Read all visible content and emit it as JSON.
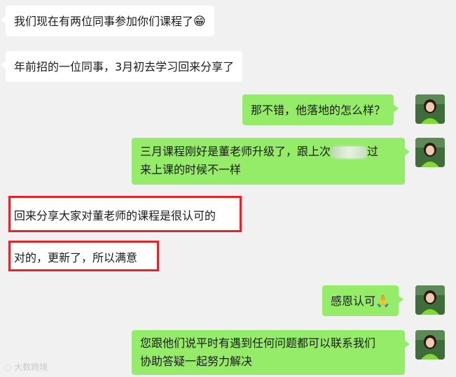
{
  "messages": [
    {
      "side": "left",
      "text": "我们现在有两位同事参加你们课程了",
      "emoji": "😁"
    },
    {
      "side": "left",
      "text": "年前招的一位同事，3月初去学习回来分享了"
    },
    {
      "side": "right",
      "text": "那不错，他落地的怎么样？"
    },
    {
      "side": "right",
      "line1_pre": "三月课程刚好是董老师升级了，跟上次",
      "line1_post": "过",
      "line2": "来上课的时候不一样"
    },
    {
      "side": "left",
      "text": "回来分享大家对董老师的课程是很认可的"
    },
    {
      "side": "left",
      "text": "对的，更新了，所以满意"
    },
    {
      "side": "right",
      "text": "感恩认可",
      "emoji": "🙏"
    },
    {
      "side": "right",
      "line1": "您跟他们说平时有遇到任何问题都可以联系我们",
      "line2": "协助答疑一起努力解决"
    }
  ],
  "watermark": "大数跨境",
  "colors": {
    "bubble_right": "#95ec69",
    "bubble_left": "#ffffff",
    "highlight": "#e0262a",
    "bg": "#f1f1f1"
  },
  "icons": {
    "avatar": "person-avatar-icon"
  }
}
